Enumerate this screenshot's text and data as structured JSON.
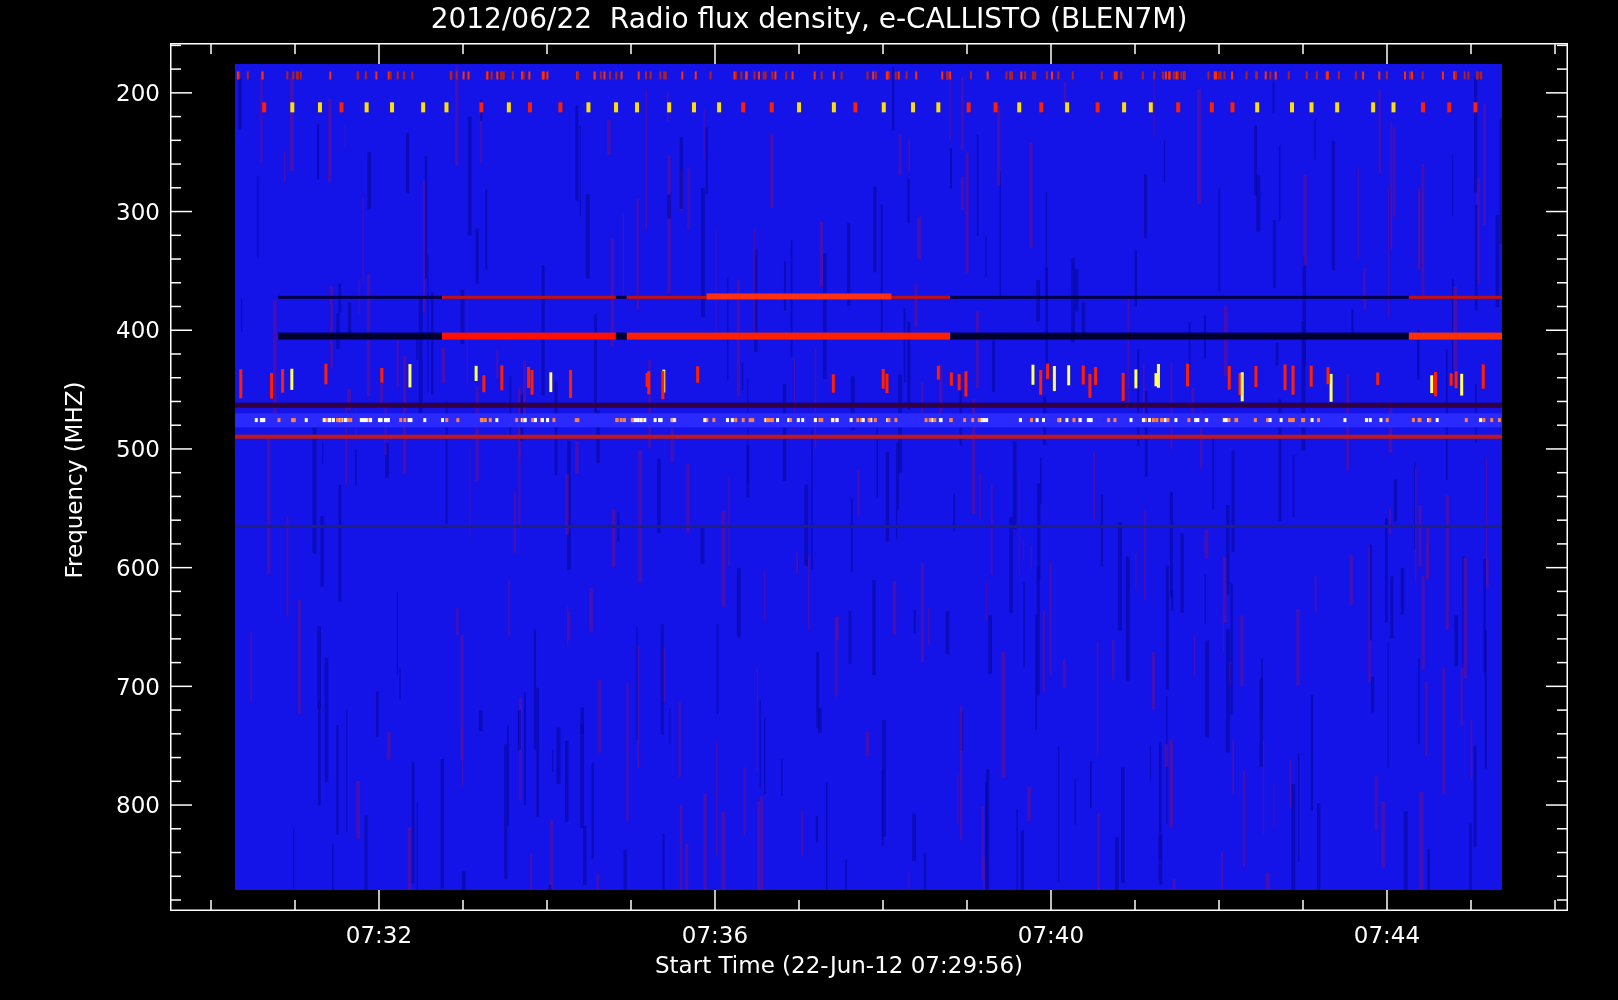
{
  "plot": {
    "title": "2012/06/22  Radio flux density, e-CALLISTO (BLEN7M)",
    "ylabel": "Frequency (MHZ)",
    "xlabel": "Start Time (22-Jun-12 07:29:56)",
    "yticks": [
      "200",
      "300",
      "400",
      "500",
      "600",
      "700",
      "800"
    ],
    "xticks": [
      "07:32",
      "07:36",
      "07:40",
      "07:44"
    ]
  }
}
